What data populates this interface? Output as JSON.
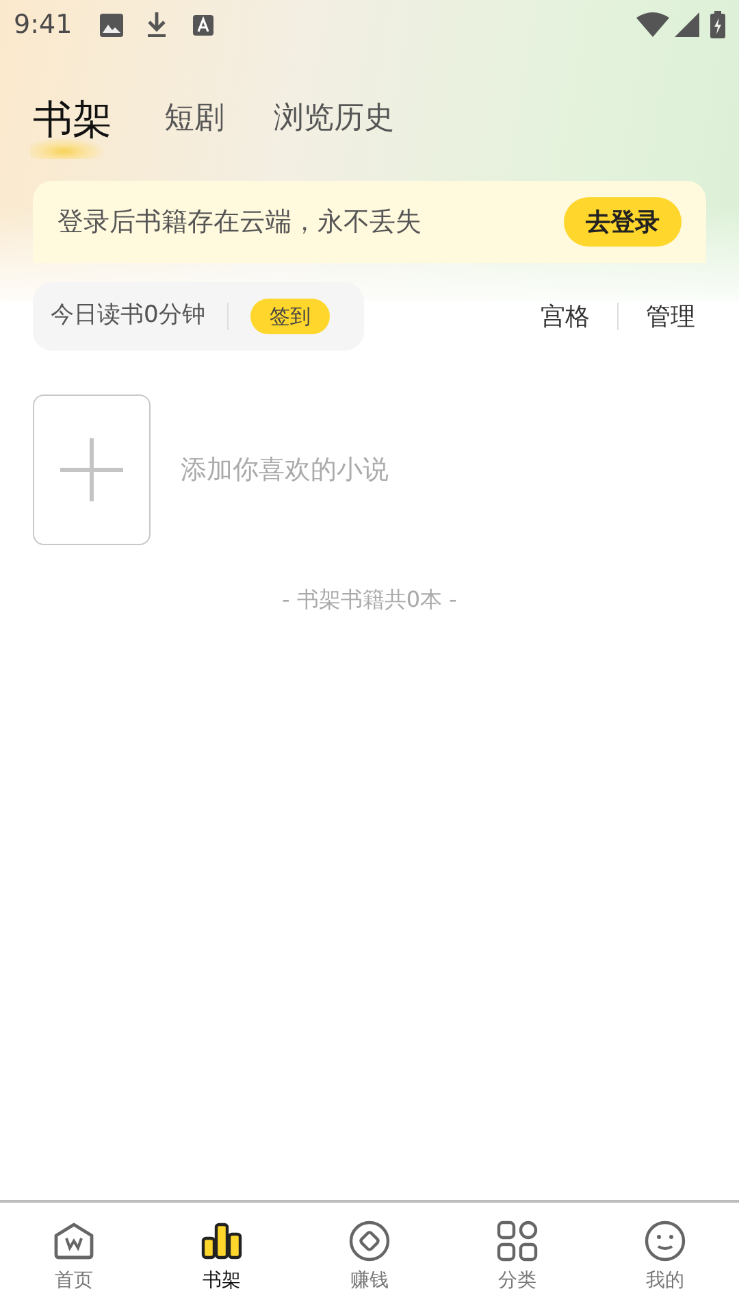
{
  "status_bar": {
    "time": "9:41"
  },
  "tabs": [
    {
      "label": "书架",
      "selected": true
    },
    {
      "label": "短剧",
      "selected": false
    },
    {
      "label": "浏览历史",
      "selected": false
    }
  ],
  "login_banner": {
    "message": "登录后书籍存在云端，永不丢失",
    "button": "去登录"
  },
  "reading_card": {
    "text": "今日读书0分钟",
    "button": "签到"
  },
  "view_actions": [
    "宫格",
    "管理"
  ],
  "add_book": {
    "hint": "添加你喜欢的小说"
  },
  "shelf_count": "- 书架书籍共0本 -",
  "bottom_nav": [
    {
      "label": "首页",
      "selected": false
    },
    {
      "label": "书架",
      "selected": true
    },
    {
      "label": "赚钱",
      "selected": false
    },
    {
      "label": "分类",
      "selected": false
    },
    {
      "label": "我的",
      "selected": false
    }
  ]
}
